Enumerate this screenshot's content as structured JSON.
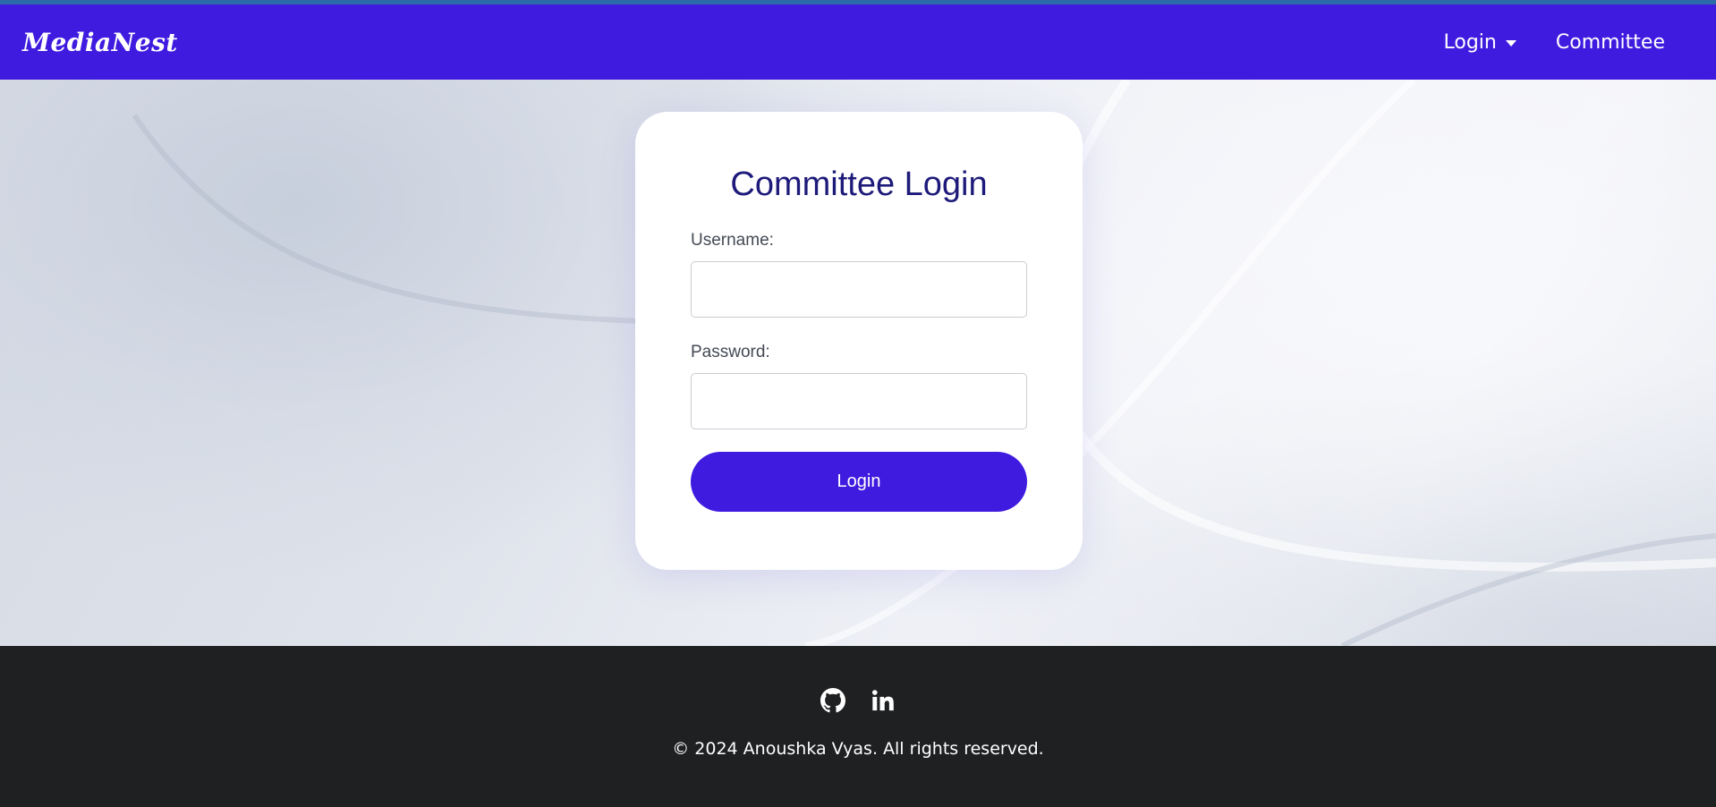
{
  "navbar": {
    "brand": "MediaNest",
    "login_label": "Login",
    "committee_label": "Committee"
  },
  "card": {
    "title": "Committee Login",
    "username_label": "Username:",
    "username_value": "",
    "password_label": "Password:",
    "password_value": "",
    "submit_label": "Login"
  },
  "footer": {
    "icons": [
      "github-icon",
      "linkedin-icon"
    ],
    "copyright": "© 2024 Anoushka Vyas. All rights reserved."
  },
  "colors": {
    "brand_primary": "#3f1be0",
    "title_color": "#1d1a7a",
    "footer_bg": "#1f2022"
  }
}
